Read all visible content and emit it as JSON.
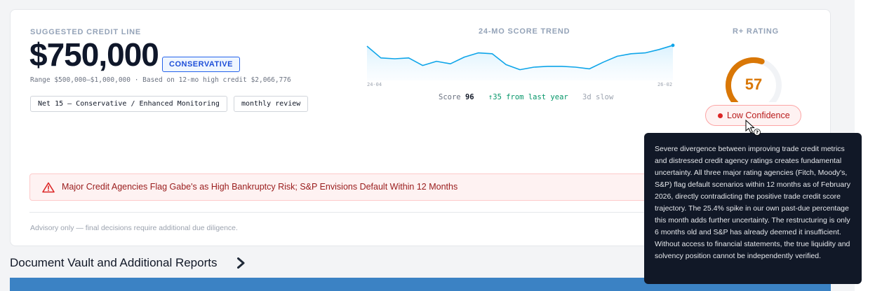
{
  "credit_line": {
    "label": "SUGGESTED CREDIT LINE",
    "amount": "$750,000",
    "badge": "CONSERVATIVE",
    "range_text": "Range $500,000–$1,000,000 · Based on 12-mo high credit $2,066,776",
    "tags": [
      "Net 15 — Conservative / Enhanced Monitoring",
      "monthly review"
    ]
  },
  "trend": {
    "label": "24-MO SCORE TREND",
    "start_tick": "24-04",
    "end_tick": "26-02",
    "score_label": "Score",
    "score_value": "96",
    "change_text": "↑35 from last year",
    "slow_text": "3d slow"
  },
  "chart_data": {
    "type": "area",
    "title": "24-MO SCORE TREND",
    "x": [
      "24-04",
      "24-05",
      "24-06",
      "24-07",
      "24-08",
      "24-09",
      "24-10",
      "24-11",
      "24-12",
      "25-01",
      "25-02",
      "25-03",
      "25-04",
      "25-05",
      "25-06",
      "25-07",
      "25-08",
      "25-09",
      "25-10",
      "25-11",
      "25-12",
      "26-01",
      "26-02"
    ],
    "values": [
      95,
      81,
      80,
      81,
      72,
      77,
      74,
      82,
      87,
      86,
      73,
      67,
      70,
      71,
      71,
      70,
      68,
      76,
      83,
      86,
      87,
      91,
      96
    ],
    "ylim": [
      55,
      100
    ],
    "xtick_labels": [
      "24-04",
      "26-02"
    ],
    "grid": false,
    "legend": "none"
  },
  "rating": {
    "label": "R+ RATING",
    "value": "57",
    "max": 100,
    "confidence": "Low Confidence",
    "gauge_color": "#d97706"
  },
  "alert": {
    "text": "Major Credit Agencies Flag Gabe's as High Bankruptcy Risk; S&P Envisions Default Within 12 Months",
    "icon": "warning-triangle-icon"
  },
  "advisory": "Advisory only — final decisions require additional due diligence.",
  "vault": {
    "title": "Document Vault and Additional Reports",
    "icon": "chevron-right-icon"
  },
  "tooltip": {
    "text": "Severe divergence between improving trade credit metrics and distressed credit agency ratings creates fundamental uncertainty. All three major rating agencies (Fitch, Moody's, S&P) flag default scenarios within 12 months as of February 2026, directly contradicting the positive trade credit score trajectory. The 25.4% spike in our own past-due percentage this month adds further uncertainty. The restructuring is only 6 months old and S&P has already deemed it insufficient. Without access to financial statements, the true liquidity and solvency position cannot be independently verified."
  },
  "colors": {
    "accent": "#1d4ed8",
    "trend_line": "#0ea5e9",
    "danger": "#dc2626",
    "table_header": "#3b82c4"
  }
}
